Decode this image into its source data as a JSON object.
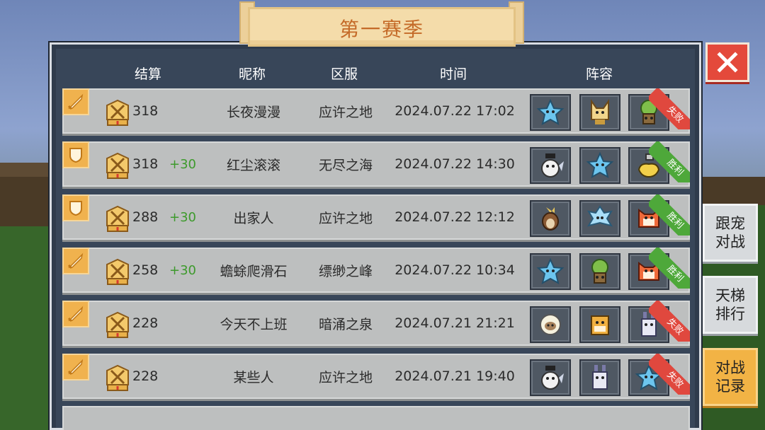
{
  "banner": {
    "title": "第一赛季"
  },
  "headers": {
    "settle": "结算",
    "nickname": "昵称",
    "server": "区服",
    "time": "时间",
    "lineup": "阵容"
  },
  "side_buttons": [
    {
      "label": "跟宠\n对战",
      "active": false
    },
    {
      "label": "天梯\n排行",
      "active": false
    },
    {
      "label": "对战\n记录",
      "active": true
    }
  ],
  "colors": {
    "win": "#4ea83a",
    "lose": "#e0483e",
    "delta": "#3d9a2c",
    "accent": "#f0b24e"
  },
  "rows": [
    {
      "type_icon": "sword-icon",
      "score": "318",
      "delta": "",
      "nickname": "长夜漫漫",
      "server": "应许之地",
      "date": "2024.07.22",
      "time": "17:02",
      "result": "失败",
      "result_kind": "lose",
      "pets": [
        "blue-star-pet-icon",
        "fox-pet-icon",
        "green-tree-pet-icon"
      ]
    },
    {
      "type_icon": "shield-icon",
      "score": "318",
      "delta": "+30",
      "nickname": "红尘滚滚",
      "server": "无尽之海",
      "date": "2024.07.22",
      "time": "14:30",
      "result": "胜利",
      "result_kind": "win",
      "pets": [
        "owl-pet-icon",
        "blue-star-pet-icon",
        "duck-pet-icon"
      ]
    },
    {
      "type_icon": "shield-icon",
      "score": "288",
      "delta": "+30",
      "nickname": "出家人",
      "server": "应许之地",
      "date": "2024.07.22",
      "time": "12:12",
      "result": "胜利",
      "result_kind": "win",
      "pets": [
        "brown-bird-pet-icon",
        "ice-bird-pet-icon",
        "fire-beast-pet-icon"
      ]
    },
    {
      "type_icon": "sword-icon",
      "score": "258",
      "delta": "+30",
      "nickname": "蟾蜍爬滑石",
      "server": "缥缈之峰",
      "date": "2024.07.22",
      "time": "10:34",
      "result": "胜利",
      "result_kind": "win",
      "pets": [
        "blue-star-pet-icon",
        "green-tree-pet-icon",
        "fire-beast-pet-icon"
      ]
    },
    {
      "type_icon": "sword-icon",
      "score": "228",
      "delta": "",
      "nickname": "今天不上班",
      "server": "暗涌之泉",
      "date": "2024.07.21",
      "time": "21:21",
      "result": "失败",
      "result_kind": "lose",
      "pets": [
        "sheep-pet-icon",
        "tiger-pet-icon",
        "bunny-pet-icon"
      ]
    },
    {
      "type_icon": "sword-icon",
      "score": "228",
      "delta": "",
      "nickname": "某些人",
      "server": "应许之地",
      "date": "2024.07.21",
      "time": "19:40",
      "result": "失败",
      "result_kind": "lose",
      "pets": [
        "owl-pet-icon",
        "bunny-pet-icon",
        "blue-star-pet-icon"
      ]
    }
  ]
}
